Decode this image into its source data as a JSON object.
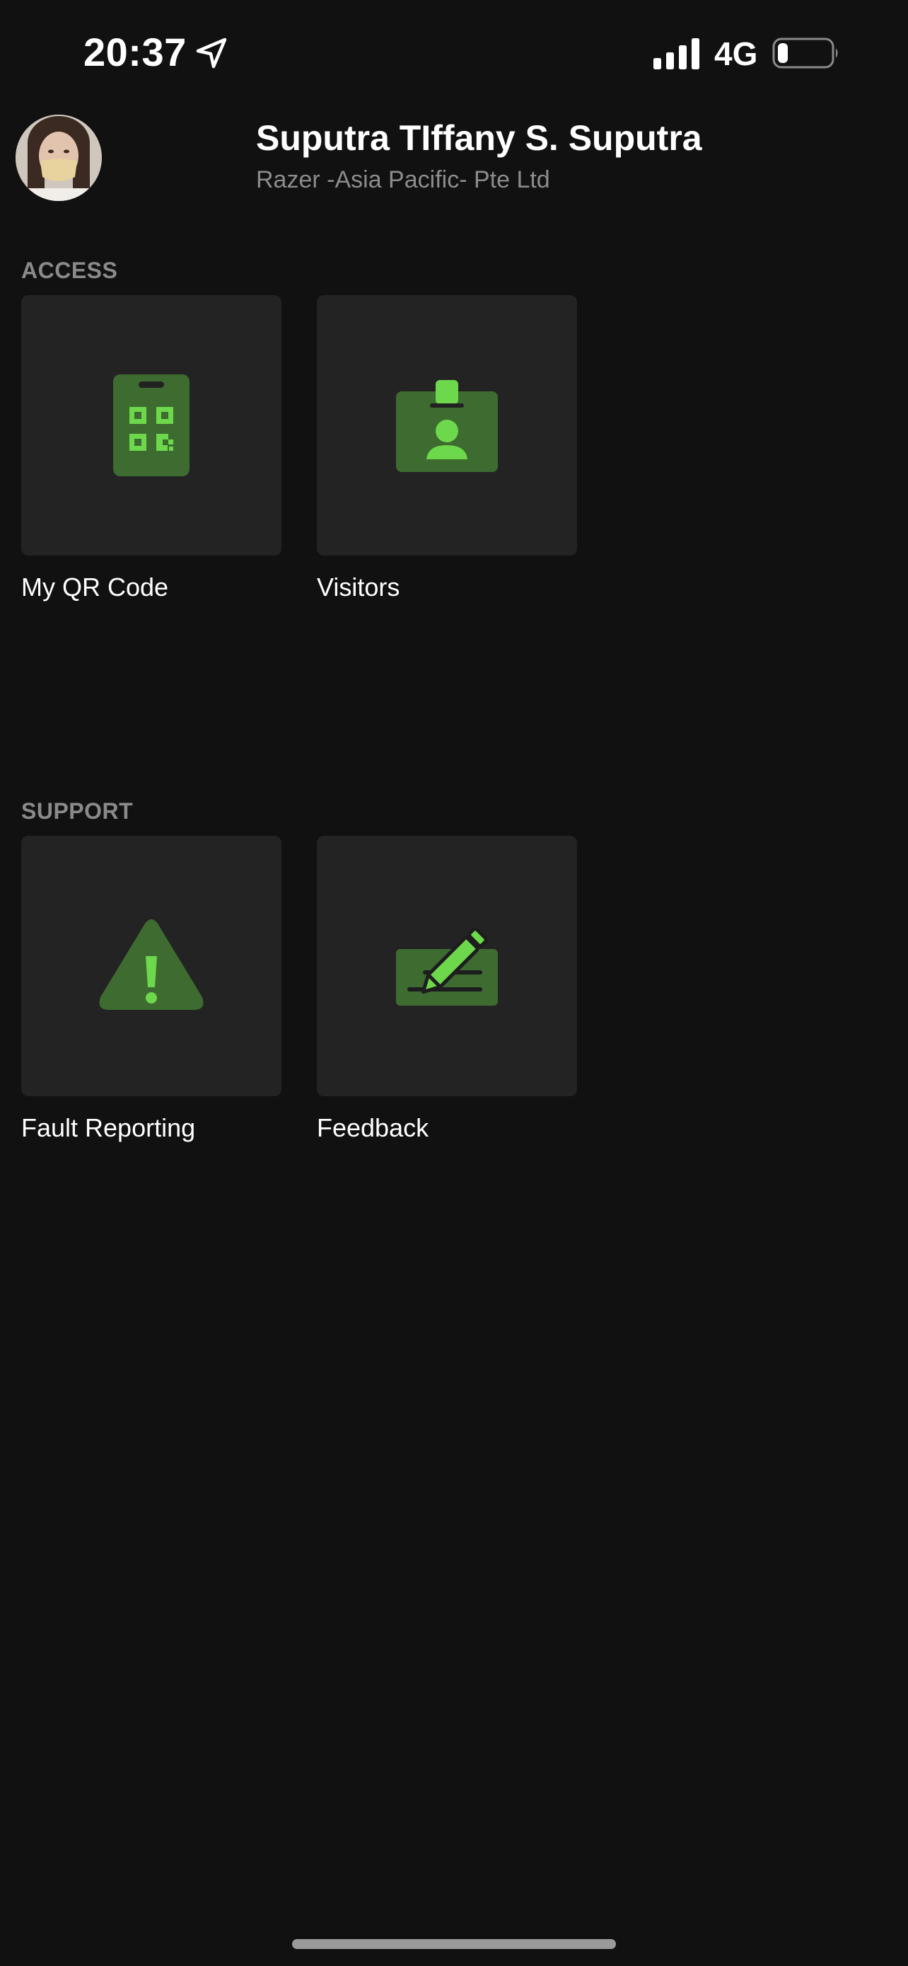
{
  "status_bar": {
    "time": "20:37",
    "network": "4G",
    "location_icon": "location-arrow-icon",
    "signal_icon": "signal-bars-icon",
    "battery_icon": "battery-low-icon",
    "battery_level": 0.2
  },
  "profile": {
    "name": "Suputra TIffany S. Suputra",
    "company": "Razer -Asia Pacific- Pte Ltd"
  },
  "sections": {
    "access": {
      "title": "ACCESS",
      "items": [
        {
          "label": "My QR Code",
          "icon": "qr-badge-icon"
        },
        {
          "label": "Visitors",
          "icon": "visitor-badge-icon"
        }
      ]
    },
    "support": {
      "title": "SUPPORT",
      "items": [
        {
          "label": "Fault Reporting",
          "icon": "warning-triangle-icon"
        },
        {
          "label": "Feedback",
          "icon": "edit-feedback-icon"
        }
      ]
    }
  },
  "colors": {
    "background": "#111111",
    "tile": "#232323",
    "accent_dark": "#3d6b30",
    "accent_light": "#6dd84c",
    "muted_text": "#8a8a8a"
  }
}
